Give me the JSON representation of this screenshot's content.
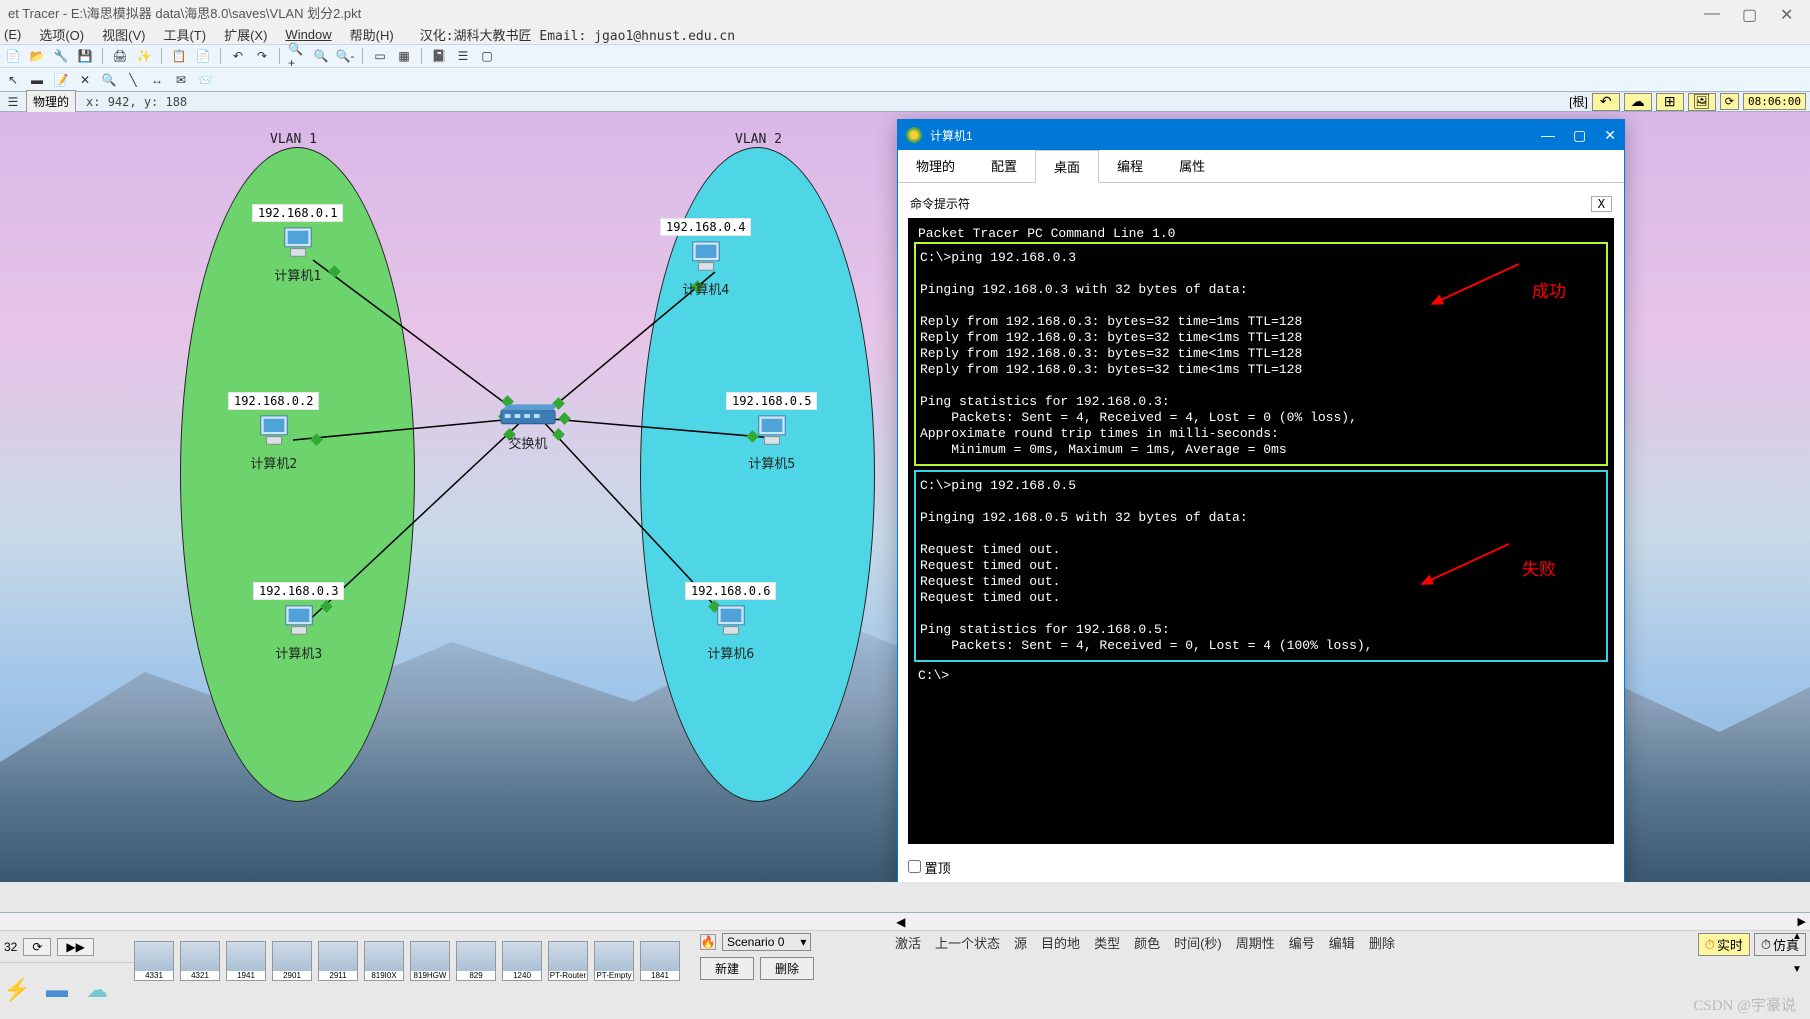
{
  "app": {
    "title": "et Tracer - E:\\海思模拟器 data\\海思8.0\\saves\\VLAN 划分2.pkt"
  },
  "menu": {
    "items": [
      "(E)",
      "选项(O)",
      "视图(V)",
      "工具(T)",
      "扩展(X)",
      "Window",
      "帮助(H)"
    ],
    "chinese_suffix": "汉化:湖科大教书匠   Email: jgao1@hnust.edu.cn"
  },
  "physical": {
    "btn": "物理的",
    "coords": "x: 942, y: 188",
    "root": "[根]",
    "time": "08:06:00"
  },
  "vlan_labels": {
    "v1": "VLAN  1",
    "v2": "VLAN  2"
  },
  "devices": {
    "pc1": {
      "ip": "192.168.0.1",
      "name": "计算机1"
    },
    "pc2": {
      "ip": "192.168.0.2",
      "name": "计算机2"
    },
    "pc3": {
      "ip": "192.168.0.3",
      "name": "计算机3"
    },
    "pc4": {
      "ip": "192.168.0.4",
      "name": "计算机4"
    },
    "pc5": {
      "ip": "192.168.0.5",
      "name": "计算机5"
    },
    "pc6": {
      "ip": "192.168.0.6",
      "name": "计算机6"
    },
    "switch": {
      "name": "交换机"
    }
  },
  "dialog": {
    "title": "计算机1",
    "tabs": [
      "物理的",
      "配置",
      "桌面",
      "编程",
      "属性"
    ],
    "prompt_title": "命令提示符",
    "x_btn": "X",
    "success_annot": "成功",
    "fail_annot": "失败",
    "term_line0": "Packet Tracer PC Command Line 1.0",
    "cmd1": "C:\\>ping 192.168.0.3",
    "ping1_header": "Pinging 192.168.0.3 with 32 bytes of data:",
    "ping1_r1": "Reply from 192.168.0.3: bytes=32 time=1ms TTL=128",
    "ping1_r2": "Reply from 192.168.0.3: bytes=32 time<1ms TTL=128",
    "ping1_r3": "Reply from 192.168.0.3: bytes=32 time<1ms TTL=128",
    "ping1_r4": "Reply from 192.168.0.3: bytes=32 time<1ms TTL=128",
    "ping1_stats1": "Ping statistics for 192.168.0.3:",
    "ping1_stats2": "    Packets: Sent = 4, Received = 4, Lost = 0 (0% loss),",
    "ping1_stats3": "Approximate round trip times in milli-seconds:",
    "ping1_stats4": "    Minimum = 0ms, Maximum = 1ms, Average = 0ms",
    "cmd2": "C:\\>ping 192.168.0.5",
    "ping2_header": "Pinging 192.168.0.5 with 32 bytes of data:",
    "ping2_r": "Request timed out.",
    "ping2_stats1": "Ping statistics for 192.168.0.5:",
    "ping2_stats2": "    Packets: Sent = 4, Received = 0, Lost = 4 (100% loss),",
    "cmd_last": "C:\\>",
    "footer_checkbox": "置顶"
  },
  "bottom": {
    "num": "32",
    "scenario_label": "Scenario 0",
    "new_btn": "新建",
    "del_btn": "删除",
    "status_cols": [
      "激活",
      "上一个状态",
      "源",
      "目的地",
      "类型",
      "颜色",
      "时间(秒)",
      "周期性",
      "编号",
      "编辑",
      "删除"
    ],
    "realtime": "实时",
    "sim": "仿真",
    "dev_labels": [
      "4331",
      "4321",
      "1941",
      "2901",
      "2911",
      "819I0X",
      "819HGW",
      "829",
      "1240",
      "PT-Router",
      "PT-Empty",
      "1841"
    ]
  },
  "watermark": "CSDN @宇豪说"
}
